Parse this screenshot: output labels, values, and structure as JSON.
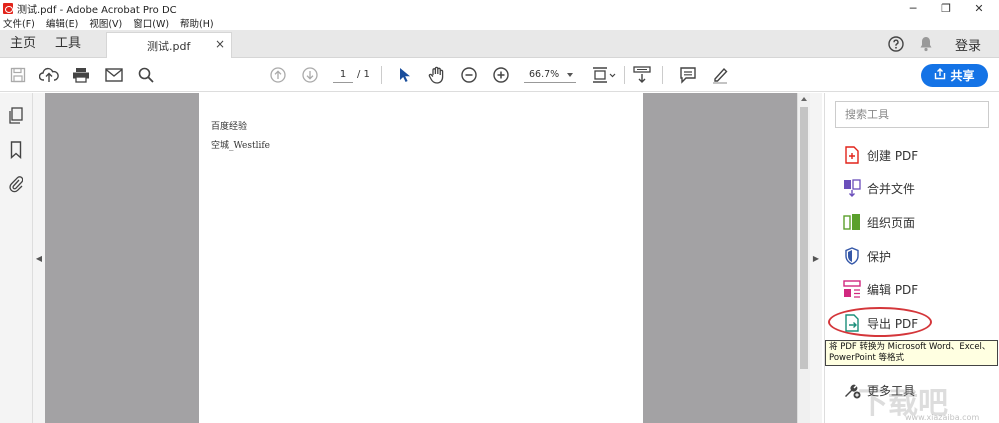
{
  "window": {
    "title": "测试.pdf - Adobe Acrobat Pro DC",
    "minimize": "─",
    "maximize": "❐",
    "close": "✕"
  },
  "menu": [
    "文件(F)",
    "编辑(E)",
    "视图(V)",
    "窗口(W)",
    "帮助(H)"
  ],
  "tabs": {
    "home": "主页",
    "tools": "工具",
    "doc": "测试.pdf",
    "doc_close": "×"
  },
  "header": {
    "login": "登录",
    "share": "共享"
  },
  "toolbar": {
    "page_current": "1",
    "page_total": "/ 1",
    "zoom": "66.7%"
  },
  "document": {
    "line1": "百度经验",
    "line2": "空城_Westlife"
  },
  "right_panel": {
    "search_placeholder": "搜索工具",
    "tools": [
      "创建 PDF",
      "合并文件",
      "组织页面",
      "保护",
      "编辑 PDF",
      "导出 PDF",
      "更多工具"
    ],
    "tooltip": "将 PDF 转换为 Microsoft Word、Excel、PowerPoint 等格式"
  },
  "watermark": {
    "text": "下载吧",
    "url": "www.xiazaiba.com"
  },
  "colors": {
    "accent": "#1473e6",
    "highlight_ring": "#d4363a",
    "doc_background": "#a3a2a4"
  }
}
